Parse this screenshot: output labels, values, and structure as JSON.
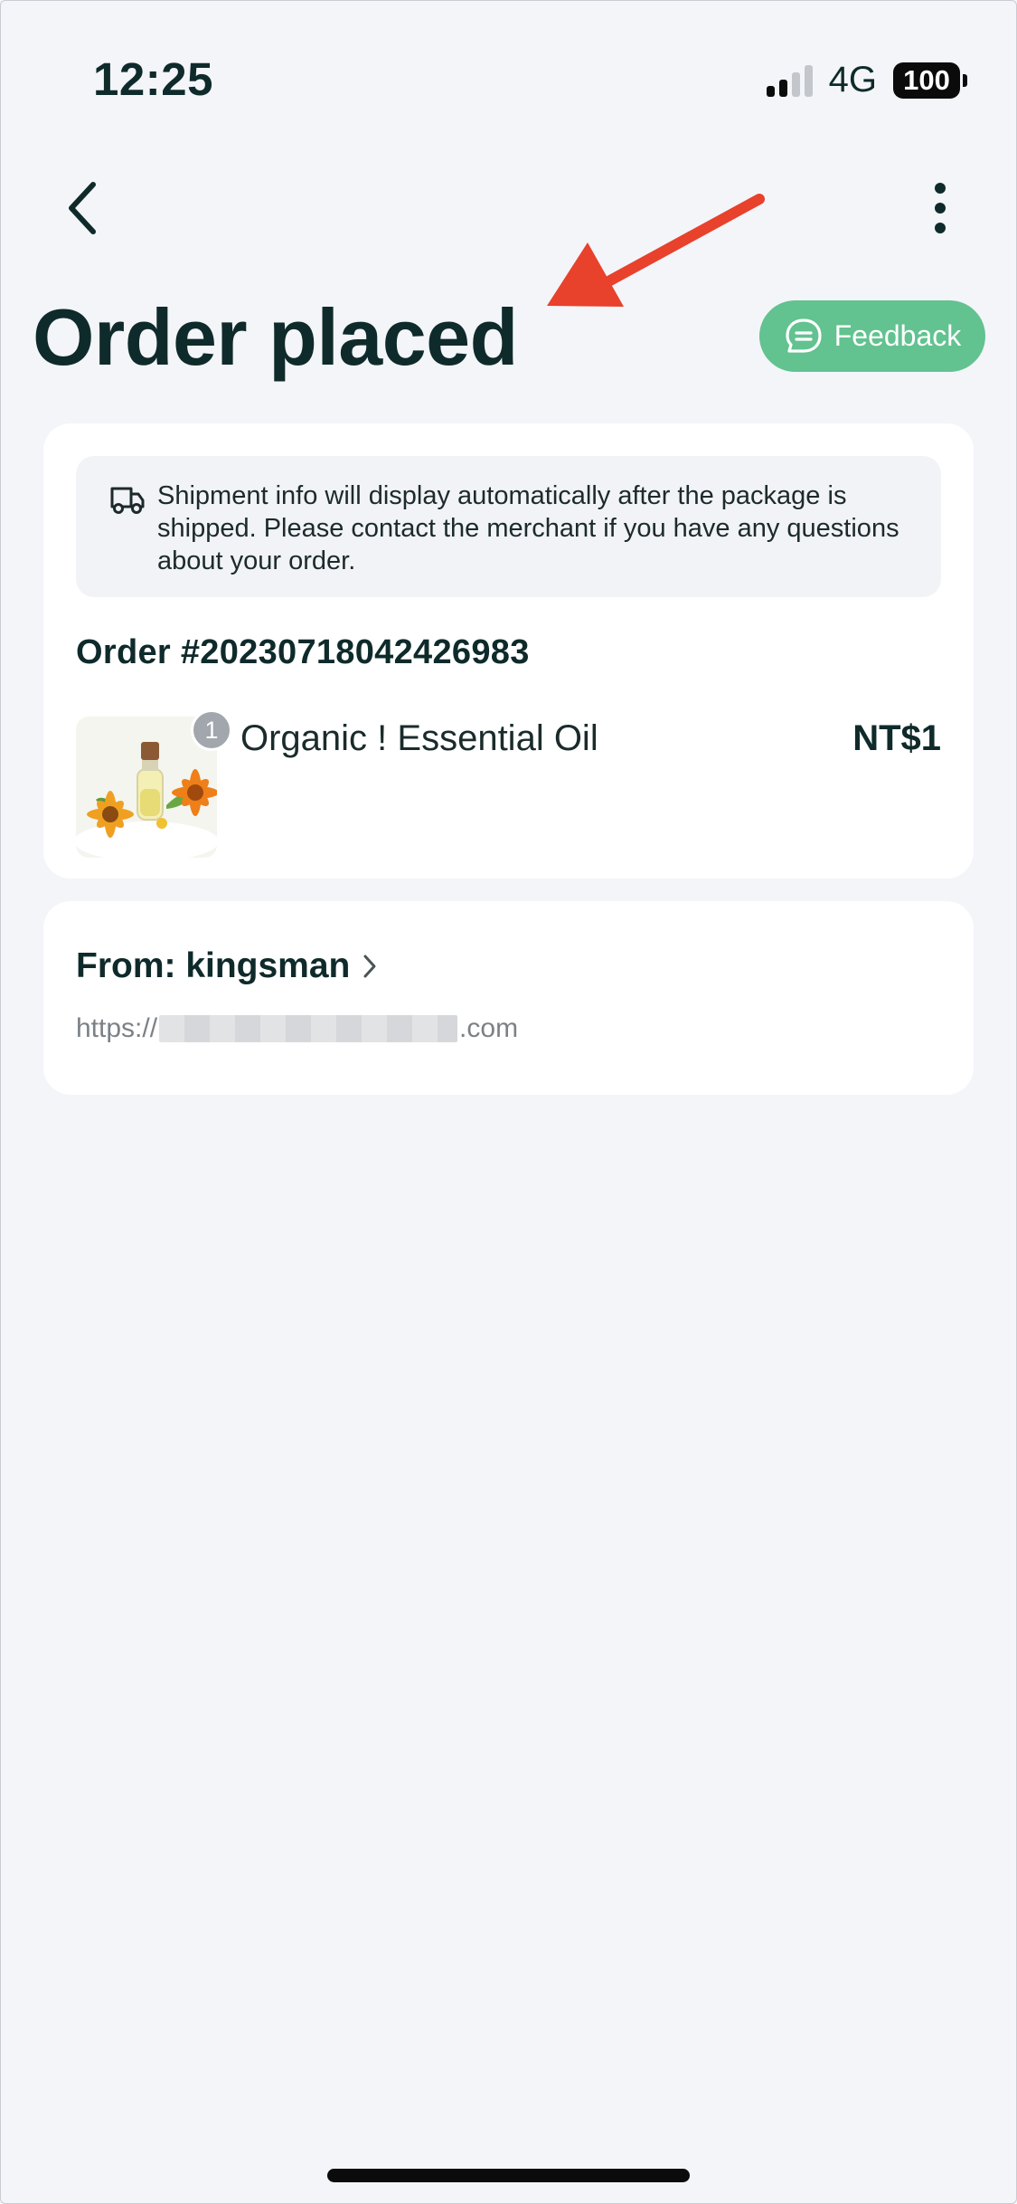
{
  "status_bar": {
    "time": "12:25",
    "network": "4G",
    "battery": "100"
  },
  "nav": {
    "back_icon": "chevron-left-icon",
    "more_icon": "more-vertical-icon"
  },
  "header": {
    "title": "Order placed",
    "feedback_label": "Feedback",
    "feedback_color": "#62c290"
  },
  "order": {
    "shipment_notice": "Shipment info will display automatically after the package is shipped. Please contact the merchant if you have any questions about your order.",
    "order_number": "Order #20230718042426983",
    "items": [
      {
        "quantity": "1",
        "name": "Organic ! Essential Oil",
        "price": "NT$1"
      }
    ]
  },
  "merchant": {
    "label": "From: kingsman",
    "url_prefix": "https://",
    "url_suffix": ".com"
  },
  "annotation": {
    "arrow_color": "#e8412c"
  }
}
